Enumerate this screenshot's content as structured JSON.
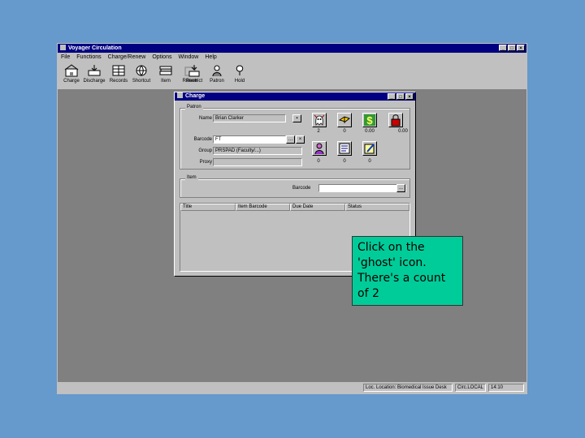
{
  "app": {
    "title": "Voyager Circulation",
    "window_buttons": [
      "_",
      "□",
      "×"
    ]
  },
  "menu": [
    "File",
    "Functions",
    "Charge/Renew",
    "Options",
    "Window",
    "Help"
  ],
  "toolbar": [
    {
      "label": "Charge",
      "icon": "charge-icon"
    },
    {
      "label": "Discharge",
      "icon": "discharge-icon"
    },
    {
      "label": "Records",
      "icon": "records-icon"
    },
    {
      "label": "Shortcut",
      "icon": "shortcut-icon"
    },
    {
      "label": "Item",
      "icon": "item-icon"
    },
    {
      "label": "Renew",
      "icon": "renew-icon"
    },
    {
      "label": "Restrict",
      "icon": "restrict-icon"
    },
    {
      "label": "Patron",
      "icon": "patron-icon"
    },
    {
      "label": "Hold",
      "icon": "hold-icon"
    }
  ],
  "dialog": {
    "title": "Charge",
    "window_buttons": [
      "_",
      "□",
      "×"
    ],
    "patron_group": {
      "label": "Patron",
      "name_label": "Name",
      "name_value": "Brian Clarker",
      "barcode_label": "Barcode",
      "barcode_value": "FT",
      "group_label": "Group",
      "group_value": "PRSPAD (Faculty/...)",
      "proxy_label": "Proxy",
      "proxy_value": ""
    },
    "counts": [
      "2",
      "0",
      "0.00",
      "0.00",
      "0",
      "0",
      "0"
    ],
    "item_group": {
      "label": "Item",
      "barcode_label": "Barcode",
      "barcode_value": "",
      "button": "..."
    },
    "list_headers": [
      "Title",
      "Item Barcode",
      "Due Date",
      "Status"
    ]
  },
  "status_bar": [
    "Loc. Location: Biomedical Issue Desk",
    "Circ.LOCAL",
    "14:10"
  ],
  "callout": "Click on the 'ghost' icon. There's a count of 2",
  "colors": {
    "desktop": "#6699cc",
    "titlebar": "#000080",
    "workspace": "#808080",
    "callout": "#00cc99"
  }
}
